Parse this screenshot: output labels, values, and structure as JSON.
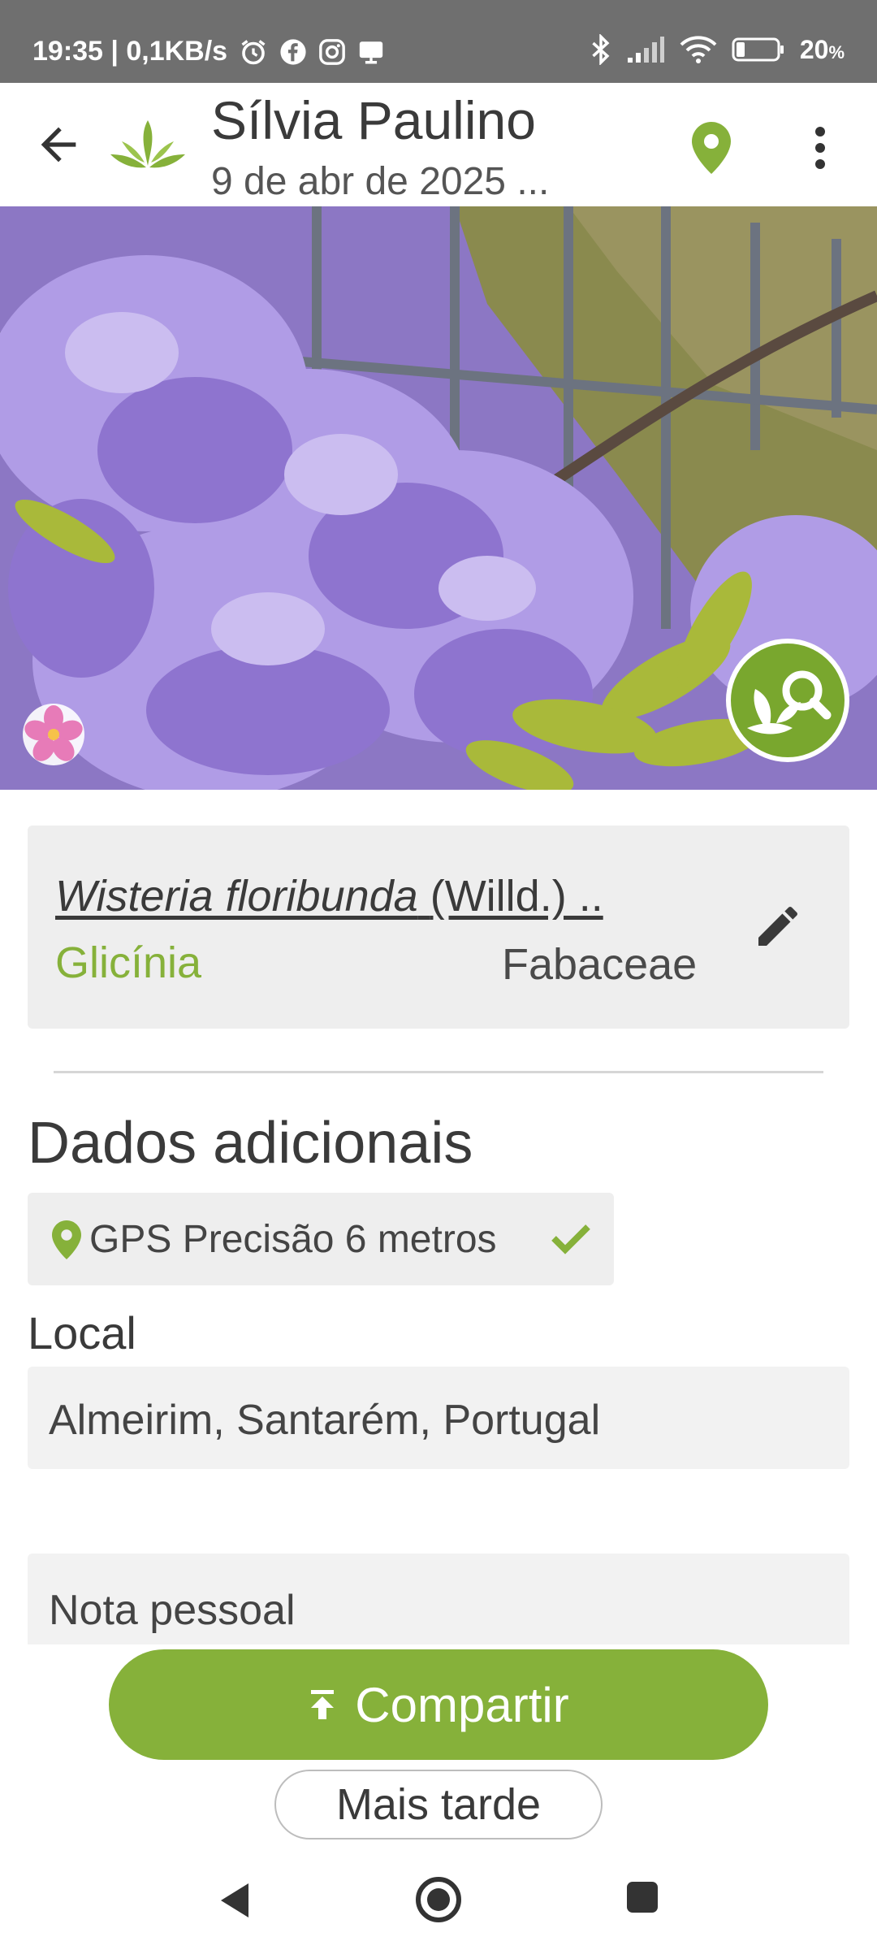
{
  "status_bar": {
    "time_speed": "19:35 | 0,1KB/s",
    "battery": "20",
    "battery_unit": "%",
    "icons": [
      "alarm-icon",
      "facebook-icon",
      "instagram-icon",
      "cast-icon",
      "bluetooth-icon",
      "signal-icon",
      "wifi-icon",
      "battery-icon"
    ]
  },
  "app_bar": {
    "title": "Sílvia Paulino",
    "subtitle": "9 de abr de 2025 ..."
  },
  "species": {
    "scientific_name": "Wisteria floribunda",
    "author": "(Willd.) ..",
    "common_name": "Glicínia",
    "family": "Fabaceae"
  },
  "additional": {
    "section_title": "Dados adicionais",
    "gps_text": "GPS Precisão 6 metros",
    "location_label": "Local",
    "location_value": "Almeirim, Santarém, Portugal",
    "note_label": "Nota pessoal"
  },
  "actions": {
    "share_label": "Compartir",
    "later_label": "Mais tarde"
  },
  "colors": {
    "accent": "#86b13a",
    "status_bar": "#6f6f6f",
    "card_bg": "#eeeeee"
  }
}
